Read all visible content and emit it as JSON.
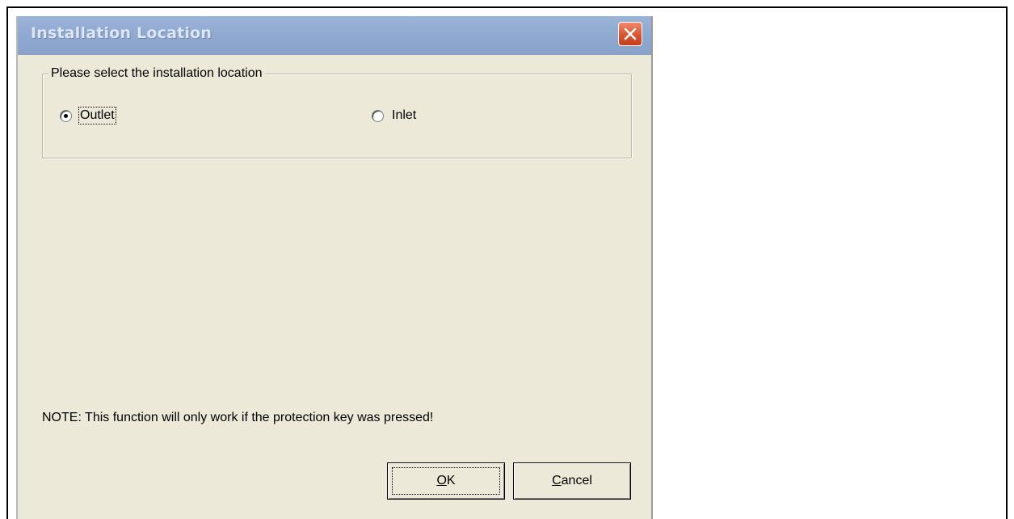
{
  "dialog": {
    "title": "Installation Location",
    "close_icon": "close-icon",
    "group": {
      "legend": "Please select the installation location",
      "options": [
        {
          "label": "Outlet",
          "selected": true
        },
        {
          "label": "Inlet",
          "selected": false
        }
      ]
    },
    "note": "NOTE: This function will only work if the protection key was pressed!",
    "buttons": {
      "ok_accel": "O",
      "ok_rest": "K",
      "cancel_accel": "C",
      "cancel_rest": "ancel"
    }
  },
  "colors": {
    "dialog_bg": "#ece9d8",
    "titlebar": "#8ea7cf",
    "close_button": "#d9542e"
  }
}
